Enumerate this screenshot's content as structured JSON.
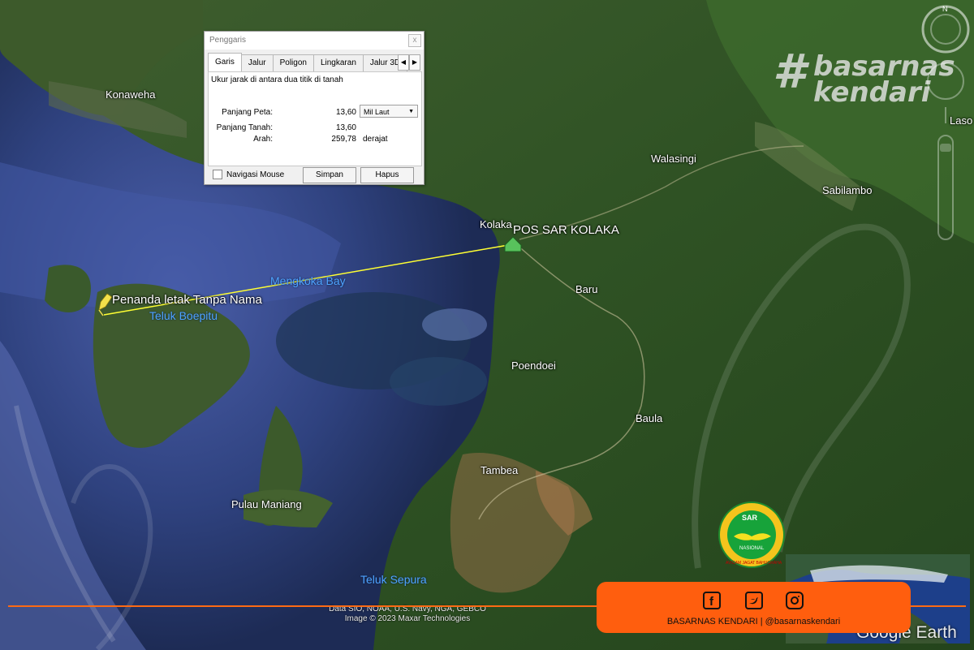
{
  "map": {
    "places": [
      {
        "name": "Konaweha"
      },
      {
        "name": "Walasingi"
      },
      {
        "name": "Sabilambo"
      },
      {
        "name": "Laso"
      },
      {
        "name": "Kolaka"
      },
      {
        "name": "Baru"
      },
      {
        "name": "Poendoei"
      },
      {
        "name": "Baula"
      },
      {
        "name": "Tambea"
      },
      {
        "name": "Pulau Maniang"
      }
    ],
    "water": [
      {
        "name": "Mengkoka Bay"
      },
      {
        "name": "Teluk Boepitu"
      },
      {
        "name": "Teluk Sepura"
      }
    ],
    "placemarks": {
      "pos_sar": "POS SAR KOLAKA",
      "unnamed": "Penanda letak Tanpa Nama"
    },
    "ruler_line_color": "#ffff33",
    "credits": [
      "Data SIO, NOAA, U.S. Navy, NGA, GEBCO",
      "Image © 2023 Maxar Technologies"
    ],
    "brand": "Google Earth"
  },
  "ruler": {
    "title": "Penggaris",
    "close": "x",
    "tabs": [
      "Garis",
      "Jalur",
      "Poligon",
      "Lingkaran",
      "Jalur 3D"
    ],
    "description": "Ukur jarak di antara dua titik di tanah",
    "map_length_label": "Panjang Peta:",
    "map_length_value": "13,60",
    "unit": "Mil Laut",
    "ground_length_label": "Panjang Tanah:",
    "ground_length_value": "13,60",
    "heading_label": "Arah:",
    "heading_value": "259,78",
    "heading_unit": "derajat",
    "mouse_nav": "Navigasi Mouse",
    "save": "Simpan",
    "clear": "Hapus"
  },
  "watermark": {
    "hash": "#",
    "line1": "basarnas",
    "line2": "kendari"
  },
  "nav": {
    "north": "N"
  },
  "social": {
    "icons": [
      "facebook-icon",
      "twitter-icon",
      "instagram-icon"
    ],
    "caption": "BASARNAS KENDARI | @basarnaskendari",
    "accent": "#ff5e0e"
  },
  "sar_logo": {
    "top": "SAR",
    "middle": "NASIONAL",
    "bottom": "AVIGAM JAGAT BAHUGRAHA"
  }
}
